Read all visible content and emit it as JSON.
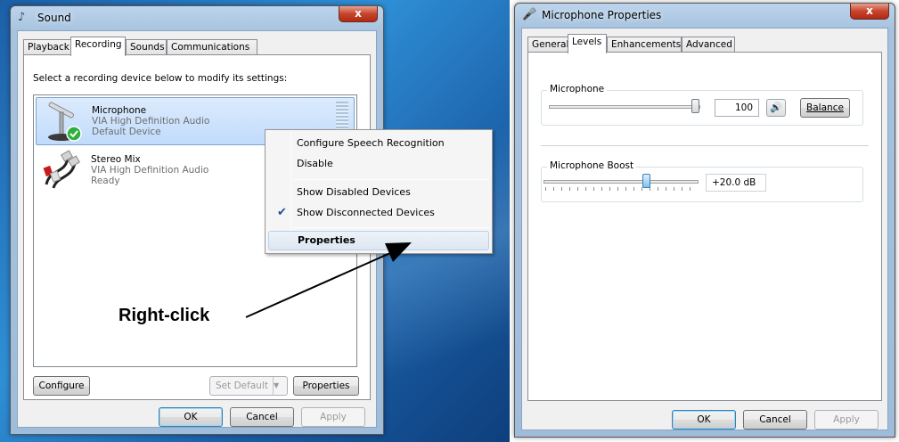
{
  "sound_window": {
    "title": "Sound",
    "close": "x",
    "tabs": [
      "Playback",
      "Recording",
      "Sounds",
      "Communications"
    ],
    "instruction": "Select a recording device below to modify its settings:",
    "devices": [
      {
        "name": "Microphone",
        "driver": "VIA High Definition Audio",
        "status": "Default Device"
      },
      {
        "name": "Stereo Mix",
        "driver": "VIA High Definition Audio",
        "status": "Ready"
      }
    ],
    "buttons": {
      "configure": "Configure",
      "set_default": "Set Default",
      "properties": "Properties",
      "ok": "OK",
      "cancel": "Cancel",
      "apply": "Apply"
    }
  },
  "context_menu": {
    "items": [
      "Configure Speech Recognition",
      "Disable",
      "Show Disabled Devices",
      "Show Disconnected Devices",
      "Properties"
    ],
    "checked_item": "Show Disconnected Devices"
  },
  "annotation": {
    "label": "Right-click"
  },
  "mic_properties": {
    "title": "Microphone Properties",
    "close": "x",
    "tabs": [
      "General",
      "Levels",
      "Enhancements",
      "Advanced"
    ],
    "microphone_group": "Microphone",
    "microphone_value": "100",
    "microphone_level": 1.0,
    "balance": "Balance",
    "boost_group": "Microphone Boost",
    "boost_value": "+20.0 dB",
    "boost_level": 0.67,
    "buttons": {
      "ok": "OK",
      "cancel": "Cancel",
      "apply": "Apply"
    }
  },
  "colors": {
    "desktop": "#1c5fa8",
    "selection": "#c1dbfc",
    "close_button": "#c7442d"
  }
}
